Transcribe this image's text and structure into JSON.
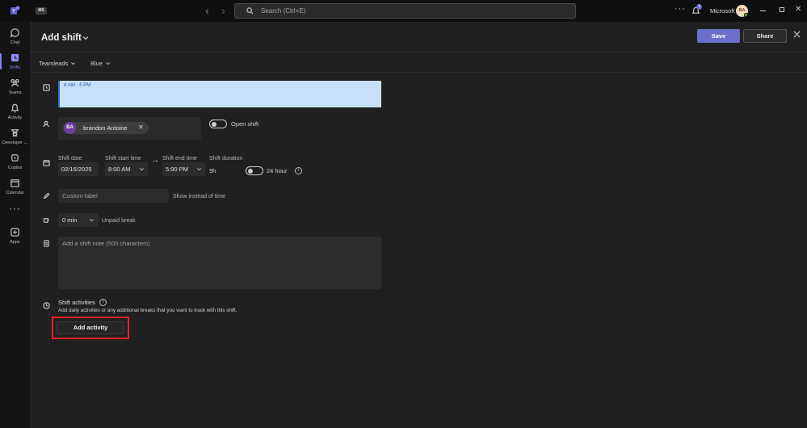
{
  "titlebar": {
    "org_badge": "MS",
    "search_placeholder": "Search (Ctrl+E)",
    "notification_count": "1",
    "org_name": "Microsoft",
    "avatar_initials": "BA"
  },
  "rail": {
    "items": [
      {
        "label": "Chat",
        "icon": "chat-icon"
      },
      {
        "label": "Shifts",
        "icon": "shifts-icon",
        "active": true
      },
      {
        "label": "Teams",
        "icon": "teams-icon"
      },
      {
        "label": "Activity",
        "icon": "bell-icon"
      },
      {
        "label": "Developer ...",
        "icon": "developer-icon"
      },
      {
        "label": "Copilot",
        "icon": "copilot-icon"
      },
      {
        "label": "Calendar",
        "icon": "calendar-icon"
      },
      {
        "label": "",
        "icon": "more-icon"
      },
      {
        "label": "Apps",
        "icon": "apps-icon"
      }
    ]
  },
  "header": {
    "title": "Add shift",
    "save_label": "Save",
    "share_label": "Share"
  },
  "filters": {
    "group": "Teamleads",
    "theme": "Blue"
  },
  "form": {
    "time_preview": "8 AM - 5 PM",
    "member_initials": "BA",
    "member_name": "brandon Antoine",
    "open_shift_label": "Open shift",
    "shift_date_label": "Shift date",
    "shift_date_value": "02/16/2025",
    "start_time_label": "Shift start time",
    "start_time_value": "8:00 AM",
    "end_time_label": "Shift end time",
    "end_time_value": "5:00 PM",
    "duration_label": "Shift duration",
    "duration_value": "9h",
    "hour24_label": "24 hour",
    "custom_label_placeholder": "Custom label",
    "show_instead_label": "Show instead of time",
    "break_value": "0 min",
    "unpaid_break_label": "Unpaid break",
    "note_placeholder": "Add a shift note (500 characters)",
    "activities_title": "Shift activities",
    "activities_description": "Add daily activities or any additional breaks that you want to track with this shift.",
    "add_activity_label": "Add activity"
  },
  "colors": {
    "accent": "#7f85f5",
    "save_button": "#6b6fc7",
    "time_preview_bg": "#c7dff7",
    "time_preview_bar": "#2b6ec8",
    "member_avatar": "#6b3fa0",
    "highlight_box": "#e8202a"
  }
}
